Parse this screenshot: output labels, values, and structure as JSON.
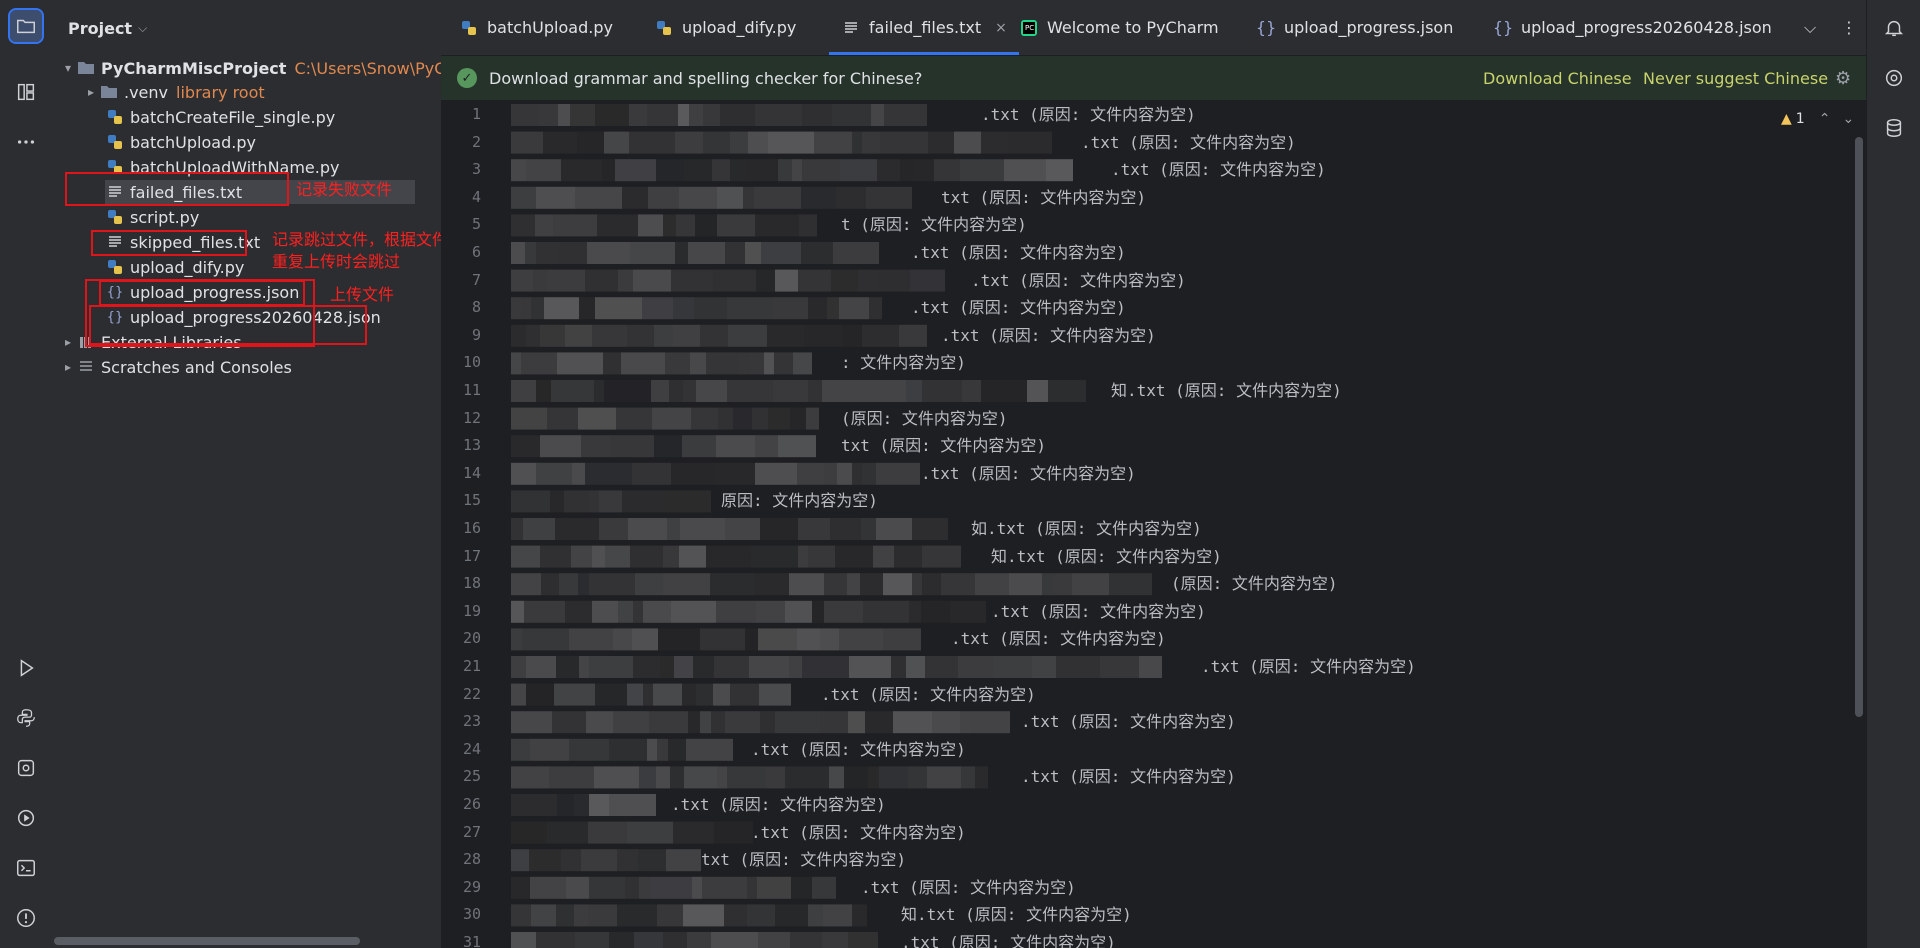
{
  "project_panel": {
    "title": "Project",
    "root": {
      "name": "PyCharmMiscProject",
      "path": "C:\\Users\\Snow\\PyCharm"
    },
    "items": [
      {
        "label": ".venv",
        "extra": "library root",
        "type": "folder"
      },
      {
        "label": "batchCreateFile_single.py",
        "type": "python"
      },
      {
        "label": "batchUpload.py",
        "type": "python"
      },
      {
        "label": "batchUploadWithName.py",
        "type": "python"
      },
      {
        "label": "failed_files.txt",
        "type": "text"
      },
      {
        "label": "script.py",
        "type": "python"
      },
      {
        "label": "skipped_files.txt",
        "type": "text"
      },
      {
        "label": "upload_dify.py",
        "type": "python"
      },
      {
        "label": "upload_progress.json",
        "type": "json"
      },
      {
        "label": "upload_progress20260428.json",
        "type": "json"
      }
    ],
    "external_libraries": "External Libraries",
    "scratches": "Scratches and Consoles"
  },
  "annotations": {
    "failed": "记录失败文件",
    "skipped_line1": "记录跳过文件，根据文件名判断",
    "skipped_line2": "重复上传时会跳过",
    "progress": "上传文件"
  },
  "tabs": [
    {
      "label": "batchUpload.py",
      "icon": "python-file-icon"
    },
    {
      "label": "upload_dify.py",
      "icon": "python-file-icon"
    },
    {
      "label": "failed_files.txt",
      "icon": "text-file-icon",
      "active": true,
      "close": "×"
    },
    {
      "label": "Welcome to PyCharm",
      "icon": "pycharm-logo-icon"
    },
    {
      "label": "upload_progress.json",
      "icon": "json-file-icon"
    },
    {
      "label": "upload_progress20260428.json",
      "icon": "json-file-icon"
    }
  ],
  "notification": {
    "message": "Download grammar and spelling checker for Chinese?",
    "action_primary": "Download Chinese",
    "action_secondary": "Never suggest Chinese"
  },
  "inspection": {
    "warnings": "1"
  },
  "editor": {
    "line_numbers": [
      "1",
      "2",
      "3",
      "4",
      "5",
      "6",
      "7",
      "8",
      "9",
      "10",
      "11",
      "12",
      "13",
      "14",
      "15",
      "16",
      "17",
      "18",
      "19",
      "20",
      "21",
      "22",
      "23",
      "24",
      "25",
      "26",
      "27",
      "28",
      "29",
      "30",
      "31"
    ],
    "lines": [
      ".txt (原因: 文件内容为空)",
      ".txt (原因: 文件内容为空)",
      ".txt (原因: 文件内容为空)",
      "txt (原因: 文件内容为空)",
      "t (原因: 文件内容为空)",
      ".txt (原因: 文件内容为空)",
      ".txt (原因: 文件内容为空)",
      ".txt (原因: 文件内容为空)",
      ".txt (原因: 文件内容为空)",
      ": 文件内容为空)",
      "知.txt (原因: 文件内容为空)",
      "(原因: 文件内容为空)",
      "txt (原因: 文件内容为空)",
      ".txt (原因: 文件内容为空)",
      "原因: 文件内容为空)",
      "如.txt (原因: 文件内容为空)",
      "知.txt (原因: 文件内容为空)",
      "(原因: 文件内容为空)",
      ".txt (原因: 文件内容为空)",
      ".txt (原因: 文件内容为空)",
      ".txt (原因: 文件内容为空)",
      ".txt (原因: 文件内容为空)",
      ".txt (原因: 文件内容为空)",
      ".txt (原因: 文件内容为空)",
      ".txt (原因: 文件内容为空)",
      ".txt (原因: 文件内容为空)",
      ".txt (原因: 文件内容为空)",
      "txt (原因: 文件内容为空)",
      ".txt (原因: 文件内容为空)",
      "知.txt (原因: 文件内容为空)",
      ".txt (原因: 文件内容为空)"
    ]
  },
  "colors": {
    "accent": "#3574f0",
    "annotation_red": "#e0151b",
    "library_orange": "#e1884f",
    "notify_link": "#c9d36b"
  }
}
